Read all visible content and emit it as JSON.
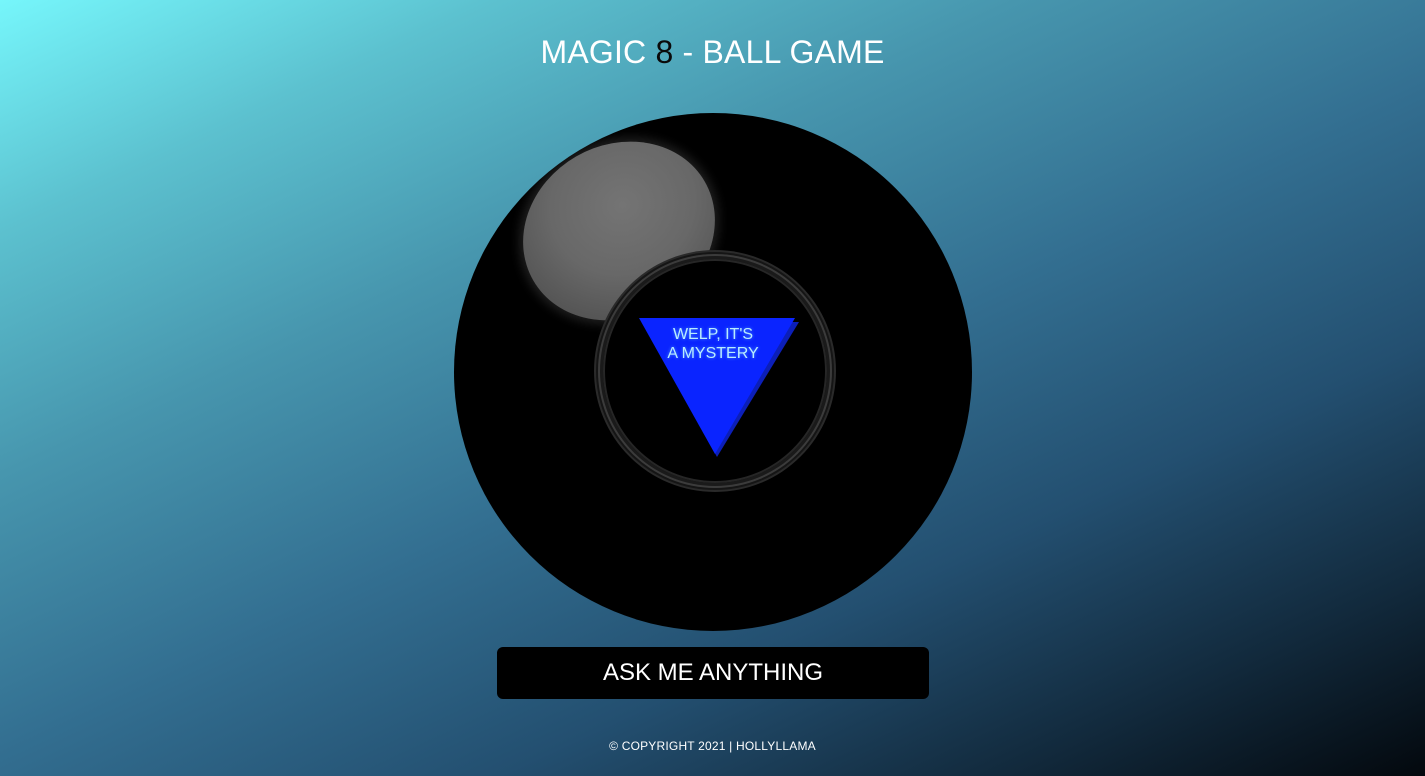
{
  "header": {
    "title_prefix": "MAGIC ",
    "title_eight": "8",
    "title_suffix": " - BALL GAME"
  },
  "ball": {
    "answer_line1": "WELP, IT'S",
    "answer_line2": "A MYSTERY",
    "triangle_color": "#0a24ff",
    "triangle_shadow_color": "#0c1fb8"
  },
  "controls": {
    "ask_button_label": "ASK ME ANYTHING"
  },
  "footer": {
    "copyright": "© COPYRIGHT 2021 | HOLLYLLAMA"
  },
  "colors": {
    "gradient_start": "#76f6fb",
    "gradient_end": "#03080d",
    "ball": "#000000",
    "button_bg": "#000000",
    "text": "#ffffff"
  }
}
